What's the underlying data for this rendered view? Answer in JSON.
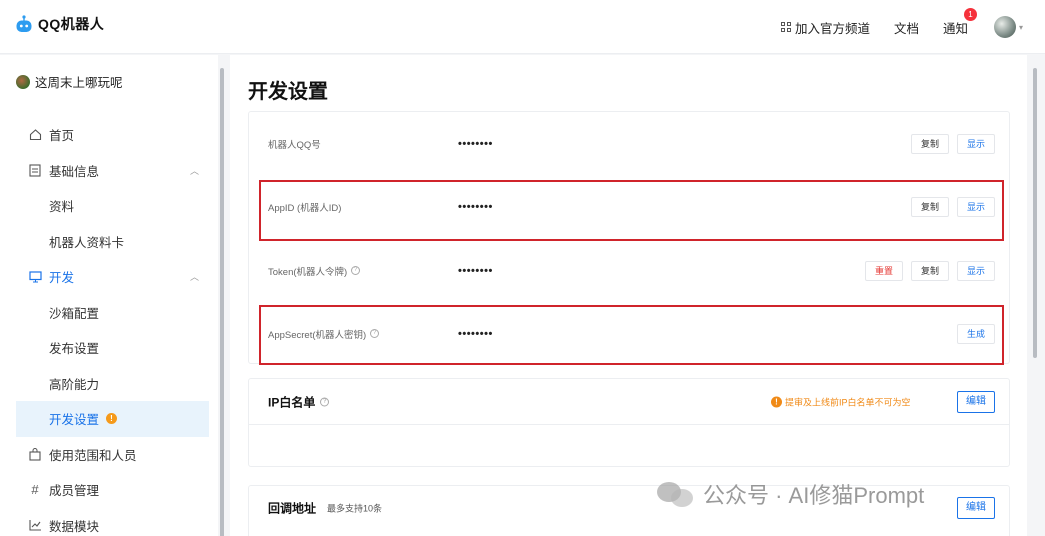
{
  "header": {
    "logo_text": "QQ机器人",
    "links": {
      "channel": "加入官方频道",
      "docs": "文档",
      "notify": "通知",
      "notify_badge": "1"
    }
  },
  "sidebar": {
    "user_name": "这周末上哪玩呢",
    "items": [
      {
        "label": "首页"
      },
      {
        "label": "基础信息"
      },
      {
        "label": "资料"
      },
      {
        "label": "机器人资料卡"
      },
      {
        "label": "开发"
      },
      {
        "label": "沙箱配置"
      },
      {
        "label": "发布设置"
      },
      {
        "label": "高阶能力"
      },
      {
        "label": "开发设置",
        "badge": "!"
      },
      {
        "label": "使用范围和人员"
      },
      {
        "label": "成员管理"
      },
      {
        "label": "数据模块"
      }
    ]
  },
  "main": {
    "title": "开发设置",
    "credentials": [
      {
        "label": "机器人QQ号",
        "value": "••••••••",
        "buttons": [
          "复制",
          "显示"
        ]
      },
      {
        "label": "AppID (机器人ID)",
        "value": "••••••••",
        "buttons": [
          "复制",
          "显示"
        ]
      },
      {
        "label": "Token(机器人令牌)",
        "value": "••••••••",
        "buttons": [
          "重置",
          "复制",
          "显示"
        ]
      },
      {
        "label": "AppSecret(机器人密钥)",
        "value": "••••••••",
        "buttons": [
          "生成"
        ]
      }
    ],
    "ip_whitelist": {
      "title": "IP白名单",
      "notice": "提审及上线前IP白名单不可为空",
      "edit": "编辑"
    },
    "callback": {
      "title": "回调地址",
      "subtitle": "最多支持10条",
      "edit": "编辑"
    }
  },
  "watermark": {
    "text": "公众号 · AI修猫Prompt"
  },
  "colors": {
    "accent": "#1a73e8",
    "highlight": "#d0242b",
    "warning": "#f08a17",
    "badge": "#f5313b"
  }
}
